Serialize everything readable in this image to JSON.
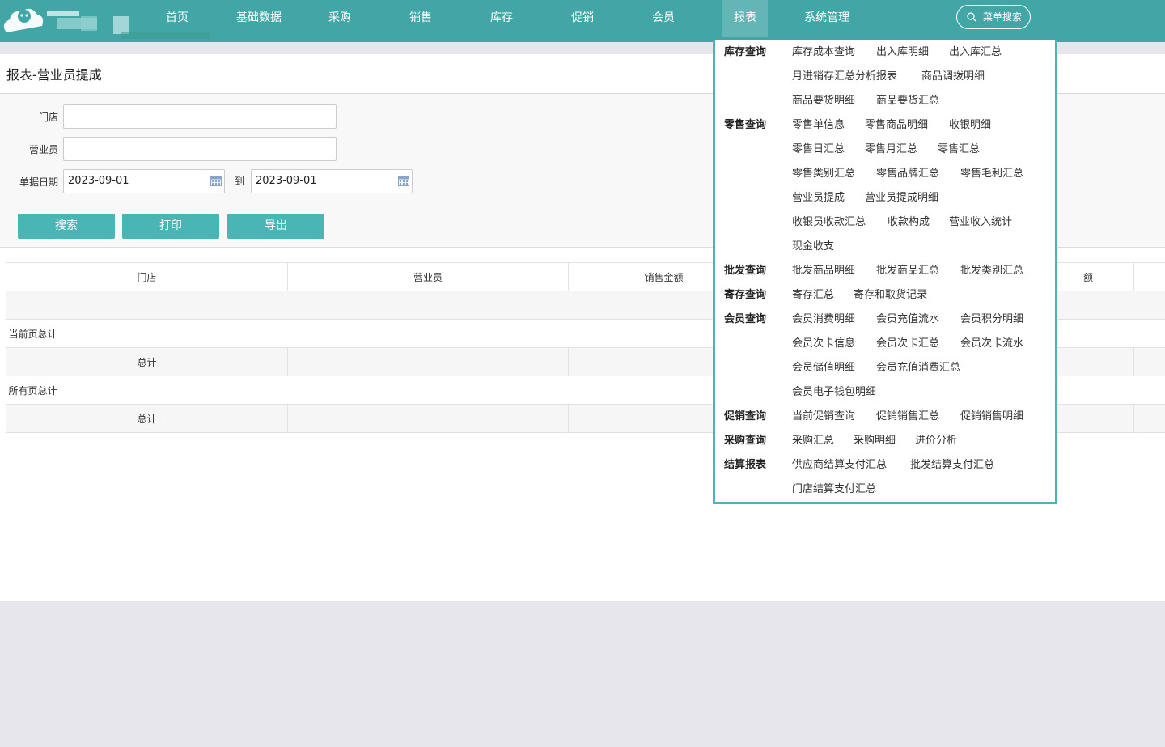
{
  "nav": {
    "items": [
      {
        "label": "首页"
      },
      {
        "label": "基础数据"
      },
      {
        "label": "采购"
      },
      {
        "label": "销售"
      },
      {
        "label": "库存"
      },
      {
        "label": "促销"
      },
      {
        "label": "会员"
      },
      {
        "label": "报表"
      },
      {
        "label": "系统管理"
      }
    ],
    "active": "报表",
    "search_label": "菜单搜索"
  },
  "page": {
    "title": "报表-营业员提成"
  },
  "form": {
    "store_label": "门店",
    "store_value": "",
    "clerk_label": "营业员",
    "clerk_value": "",
    "date_label": "单据日期",
    "date_from": "2023-09-01",
    "date_to_label": "到",
    "date_to": "2023-09-01",
    "buttons": {
      "search": "搜索",
      "print": "打印",
      "export": "导出"
    }
  },
  "table": {
    "headers": [
      "门店",
      "营业员",
      "销售金额",
      "额"
    ],
    "current_page_total_label": "当前页总计",
    "all_pages_total_label": "所有页总计",
    "total_label": "总计"
  },
  "dropdown": {
    "categories": [
      {
        "name": "库存查询",
        "links": [
          "库存成本查询",
          "出入库明细",
          "出入库汇总",
          "月进销存汇总分析报表",
          "商品调拨明细",
          "商品要货明细",
          "商品要货汇总"
        ]
      },
      {
        "name": "零售查询",
        "links": [
          "零售单信息",
          "零售商品明细",
          "收银明细",
          "零售日汇总",
          "零售月汇总",
          "零售汇总",
          "零售类别汇总",
          "零售品牌汇总",
          "零售毛利汇总",
          "营业员提成",
          "营业员提成明细",
          "收银员收款汇总",
          "收款构成",
          "营业收入统计",
          "现金收支"
        ]
      },
      {
        "name": "批发查询",
        "links": [
          "批发商品明细",
          "批发商品汇总",
          "批发类别汇总"
        ]
      },
      {
        "name": "寄存查询",
        "links": [
          "寄存汇总",
          "寄存和取货记录"
        ]
      },
      {
        "name": "会员查询",
        "links": [
          "会员消费明细",
          "会员充值流水",
          "会员积分明细",
          "会员次卡信息",
          "会员次卡汇总",
          "会员次卡流水",
          "会员储值明细",
          "会员充值消费汇总",
          "会员电子钱包明细"
        ]
      },
      {
        "name": "促销查询",
        "links": [
          "当前促销查询",
          "促销销售汇总",
          "促销销售明细"
        ]
      },
      {
        "name": "采购查询",
        "links": [
          "采购汇总",
          "采购明细",
          "进价分析"
        ]
      },
      {
        "name": "结算报表",
        "links": [
          "供应商结算支付汇总",
          "批发结算支付汇总",
          "门店结算支付汇总"
        ]
      }
    ]
  }
}
